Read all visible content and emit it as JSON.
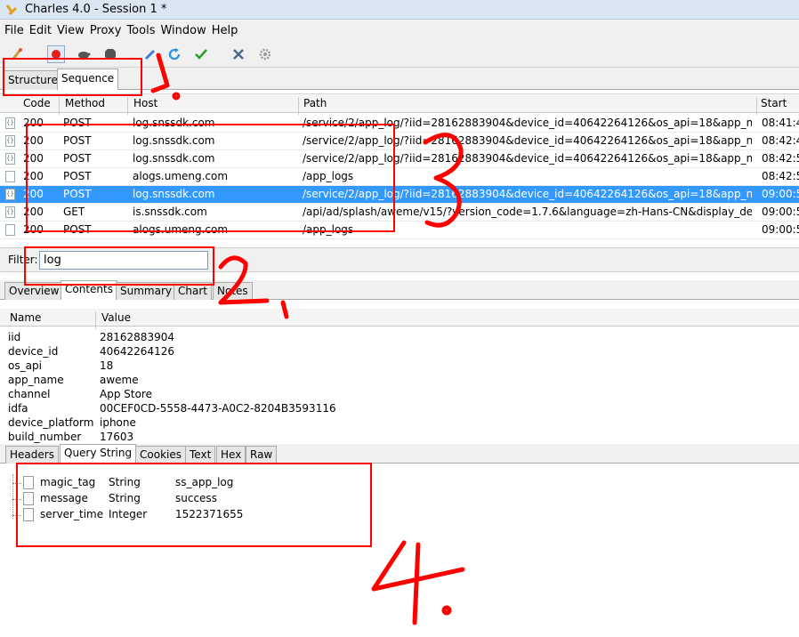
{
  "window": {
    "title": "Charles 4.0 - Session 1 *"
  },
  "menu": [
    "File",
    "Edit",
    "View",
    "Proxy",
    "Tools",
    "Window",
    "Help"
  ],
  "toolbar": {
    "icons": [
      "broom-icon",
      "record-icon",
      "turtle-icon",
      "stop-icon",
      "pen-icon",
      "refresh-icon",
      "check-icon",
      "tools-icon",
      "gear-icon"
    ]
  },
  "view_tabs": [
    "Structure",
    "Sequence"
  ],
  "grid": {
    "columns": [
      "Code",
      "Method",
      "Host",
      "Path",
      "Start"
    ],
    "rows": [
      {
        "code": "200",
        "method": "POST",
        "host": "log.snssdk.com",
        "path": "/service/2/app_log/?iid=28162883904&device_id=40642264126&os_api=18&app_na...",
        "start": "08:41:4"
      },
      {
        "code": "200",
        "method": "POST",
        "host": "log.snssdk.com",
        "path": "/service/2/app_log/?iid=28162883904&device_id=40642264126&os_api=18&app_na...",
        "start": "08:42:4"
      },
      {
        "code": "200",
        "method": "POST",
        "host": "log.snssdk.com",
        "path": "/service/2/app_log/?iid=28162883904&device_id=40642264126&os_api=18&app_na...",
        "start": "08:42:5"
      },
      {
        "code": "200",
        "method": "POST",
        "host": "alogs.umeng.com",
        "path": "/app_logs",
        "start": "08:42:5"
      },
      {
        "code": "200",
        "method": "POST",
        "host": "log.snssdk.com",
        "path": "/service/2/app_log/?iid=28162883904&device_id=40642264126&os_api=18&app_na...",
        "start": "09:00:5"
      },
      {
        "code": "200",
        "method": "GET",
        "host": "is.snssdk.com",
        "path": "/api/ad/splash/aweme/v15/?version_code=1.7.6&language=zh-Hans-CN&display_de...",
        "start": "09:00:5"
      },
      {
        "code": "200",
        "method": "POST",
        "host": "alogs.umeng.com",
        "path": "/app_logs",
        "start": "09:00:5"
      }
    ]
  },
  "filter": {
    "label": "Filter:",
    "value": "log"
  },
  "detail_tabs": [
    "Overview",
    "Contents",
    "Summary",
    "Chart",
    "Notes"
  ],
  "kv": {
    "columns": [
      "Name",
      "Value"
    ],
    "rows": [
      {
        "name": "iid",
        "value": "28162883904"
      },
      {
        "name": "device_id",
        "value": "40642264126"
      },
      {
        "name": "os_api",
        "value": "18"
      },
      {
        "name": "app_name",
        "value": "aweme"
      },
      {
        "name": "channel",
        "value": "App Store"
      },
      {
        "name": "idfa",
        "value": "00CEF0CD-5558-4473-A0C2-8204B3593116"
      },
      {
        "name": "device_platform",
        "value": "iphone"
      },
      {
        "name": "build_number",
        "value": "17603"
      }
    ]
  },
  "body_tabs": [
    "Headers",
    "Query String",
    "Cookies",
    "Text",
    "Hex",
    "Raw"
  ],
  "tree": [
    {
      "name": "magic_tag",
      "type": "String",
      "value": "ss_app_log"
    },
    {
      "name": "message",
      "type": "String",
      "value": "success"
    },
    {
      "name": "server_time",
      "type": "Integer",
      "value": "1522371655"
    }
  ],
  "annotations": {
    "color": "#ff0000",
    "marks": [
      "1.",
      "2.",
      "3",
      "4."
    ]
  }
}
